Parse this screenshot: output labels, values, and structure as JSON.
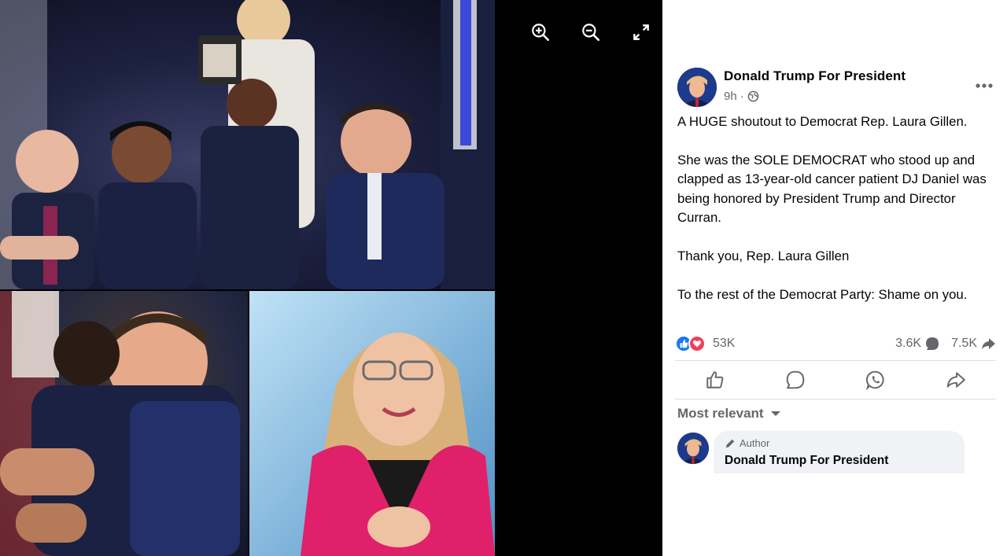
{
  "viewer": {
    "tools": [
      {
        "name": "zoom-in",
        "icon": "zoom-in-icon"
      },
      {
        "name": "zoom-out",
        "icon": "zoom-out-icon"
      },
      {
        "name": "fullscreen",
        "icon": "fullscreen-icon"
      }
    ],
    "icon_color": "#ffffff"
  },
  "post": {
    "author": "Donald Trump For President",
    "time": "9h",
    "audience_icon": "globe-icon",
    "paragraphs": [
      "A HUGE shoutout to Democrat Rep. Laura Gillen.",
      "She was the SOLE DEMOCRAT who stood up and clapped as 13-year-old cancer patient DJ Daniel was being honored by President Trump and Director Curran.",
      "Thank you, Rep. Laura Gillen",
      "To the rest of the Democrat Party: Shame on you."
    ],
    "reactions_count": "53K",
    "comments_count": "3.6K",
    "shares_count": "7.5K",
    "colors": {
      "like": "#1877f2",
      "love": "#f33e58",
      "muted_text": "#65676b"
    }
  },
  "actions": [
    {
      "name": "like",
      "icon": "thumbs-up-icon"
    },
    {
      "name": "comment",
      "icon": "comment-icon"
    },
    {
      "name": "whatsapp",
      "icon": "whatsapp-icon"
    },
    {
      "name": "share",
      "icon": "share-icon"
    }
  ],
  "comments": {
    "sort_label": "Most relevant",
    "items": [
      {
        "badge": "Author",
        "name": "Donald Trump For President"
      }
    ]
  }
}
